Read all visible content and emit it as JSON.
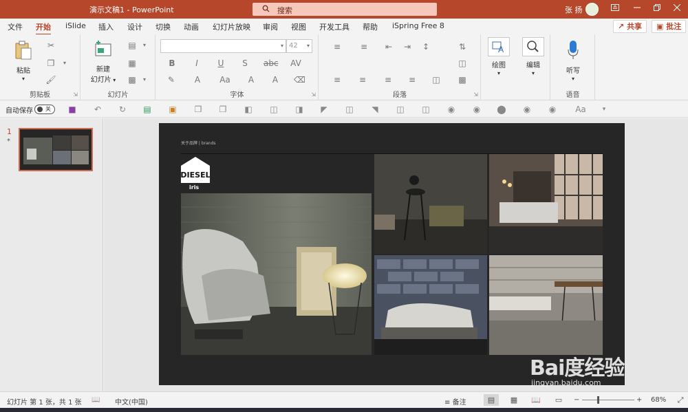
{
  "titlebar": {
    "doc_title": "演示文稿1  -  PowerPoint",
    "search_placeholder": "搜索",
    "user_name": "张 扬",
    "bg_color": "#b7472a"
  },
  "menu": {
    "tabs": [
      "文件",
      "开始",
      "iSlide",
      "插入",
      "设计",
      "切换",
      "动画",
      "幻灯片放映",
      "审阅",
      "视图",
      "开发工具",
      "帮助",
      "iSpring Free 8"
    ],
    "active_tab": "开始",
    "share_label": "共享",
    "comment_label": "批注"
  },
  "ribbon": {
    "clipboard": {
      "paste_label": "粘贴",
      "group_label": "剪贴板"
    },
    "slides": {
      "new_slide_label": "新建\n幻灯片",
      "group_label": "幻灯片"
    },
    "font": {
      "font_name": "",
      "font_size": "42",
      "group_label": "字体"
    },
    "paragraph": {
      "group_label": "段落"
    },
    "drawing": {
      "draw_label": "绘图"
    },
    "editing": {
      "edit_label": "编辑"
    },
    "voice": {
      "dictate_label": "听写",
      "group_label": "语音"
    }
  },
  "qat": {
    "autosave_label": "自动保存",
    "toggle_state": "关"
  },
  "thumbnails": {
    "slide_number": "1",
    "marker": "*"
  },
  "slide": {
    "header_text": "关于品牌 | brands",
    "logo_text": "DIESEL",
    "logo_sub": "iris"
  },
  "statusbar": {
    "slide_info": "幻灯片 第 1 张，共 1 张",
    "language": "中文(中国)",
    "notes_label": "备注",
    "zoom_level": "68%"
  },
  "watermark": {
    "brand": "Bai度经验",
    "url": "jingyan.baidu.com"
  }
}
